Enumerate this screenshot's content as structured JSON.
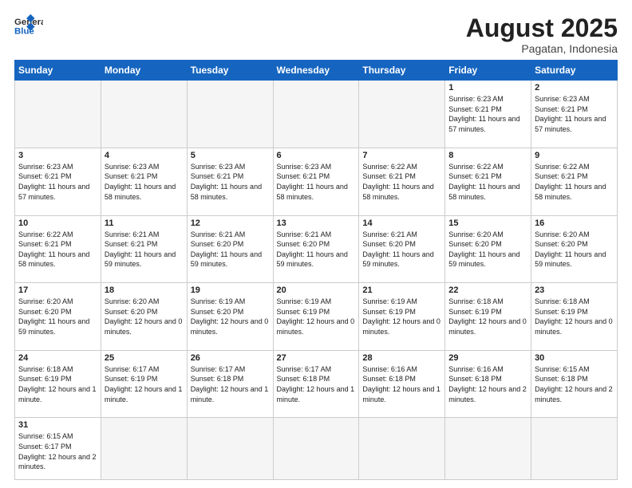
{
  "header": {
    "logo_general": "General",
    "logo_blue": "Blue",
    "month_title": "August 2025",
    "subtitle": "Pagatan, Indonesia"
  },
  "weekdays": [
    "Sunday",
    "Monday",
    "Tuesday",
    "Wednesday",
    "Thursday",
    "Friday",
    "Saturday"
  ],
  "rows": [
    [
      {
        "day": "",
        "info": "",
        "empty": true
      },
      {
        "day": "",
        "info": "",
        "empty": true
      },
      {
        "day": "",
        "info": "",
        "empty": true
      },
      {
        "day": "",
        "info": "",
        "empty": true
      },
      {
        "day": "",
        "info": "",
        "empty": true
      },
      {
        "day": "1",
        "info": "Sunrise: 6:23 AM\nSunset: 6:21 PM\nDaylight: 11 hours\nand 57 minutes."
      },
      {
        "day": "2",
        "info": "Sunrise: 6:23 AM\nSunset: 6:21 PM\nDaylight: 11 hours\nand 57 minutes."
      }
    ],
    [
      {
        "day": "3",
        "info": "Sunrise: 6:23 AM\nSunset: 6:21 PM\nDaylight: 11 hours\nand 57 minutes."
      },
      {
        "day": "4",
        "info": "Sunrise: 6:23 AM\nSunset: 6:21 PM\nDaylight: 11 hours\nand 58 minutes."
      },
      {
        "day": "5",
        "info": "Sunrise: 6:23 AM\nSunset: 6:21 PM\nDaylight: 11 hours\nand 58 minutes."
      },
      {
        "day": "6",
        "info": "Sunrise: 6:23 AM\nSunset: 6:21 PM\nDaylight: 11 hours\nand 58 minutes."
      },
      {
        "day": "7",
        "info": "Sunrise: 6:22 AM\nSunset: 6:21 PM\nDaylight: 11 hours\nand 58 minutes."
      },
      {
        "day": "8",
        "info": "Sunrise: 6:22 AM\nSunset: 6:21 PM\nDaylight: 11 hours\nand 58 minutes."
      },
      {
        "day": "9",
        "info": "Sunrise: 6:22 AM\nSunset: 6:21 PM\nDaylight: 11 hours\nand 58 minutes."
      }
    ],
    [
      {
        "day": "10",
        "info": "Sunrise: 6:22 AM\nSunset: 6:21 PM\nDaylight: 11 hours\nand 58 minutes."
      },
      {
        "day": "11",
        "info": "Sunrise: 6:21 AM\nSunset: 6:21 PM\nDaylight: 11 hours\nand 59 minutes."
      },
      {
        "day": "12",
        "info": "Sunrise: 6:21 AM\nSunset: 6:20 PM\nDaylight: 11 hours\nand 59 minutes."
      },
      {
        "day": "13",
        "info": "Sunrise: 6:21 AM\nSunset: 6:20 PM\nDaylight: 11 hours\nand 59 minutes."
      },
      {
        "day": "14",
        "info": "Sunrise: 6:21 AM\nSunset: 6:20 PM\nDaylight: 11 hours\nand 59 minutes."
      },
      {
        "day": "15",
        "info": "Sunrise: 6:20 AM\nSunset: 6:20 PM\nDaylight: 11 hours\nand 59 minutes."
      },
      {
        "day": "16",
        "info": "Sunrise: 6:20 AM\nSunset: 6:20 PM\nDaylight: 11 hours\nand 59 minutes."
      }
    ],
    [
      {
        "day": "17",
        "info": "Sunrise: 6:20 AM\nSunset: 6:20 PM\nDaylight: 11 hours\nand 59 minutes."
      },
      {
        "day": "18",
        "info": "Sunrise: 6:20 AM\nSunset: 6:20 PM\nDaylight: 12 hours\nand 0 minutes."
      },
      {
        "day": "19",
        "info": "Sunrise: 6:19 AM\nSunset: 6:20 PM\nDaylight: 12 hours\nand 0 minutes."
      },
      {
        "day": "20",
        "info": "Sunrise: 6:19 AM\nSunset: 6:19 PM\nDaylight: 12 hours\nand 0 minutes."
      },
      {
        "day": "21",
        "info": "Sunrise: 6:19 AM\nSunset: 6:19 PM\nDaylight: 12 hours\nand 0 minutes."
      },
      {
        "day": "22",
        "info": "Sunrise: 6:18 AM\nSunset: 6:19 PM\nDaylight: 12 hours\nand 0 minutes."
      },
      {
        "day": "23",
        "info": "Sunrise: 6:18 AM\nSunset: 6:19 PM\nDaylight: 12 hours\nand 0 minutes."
      }
    ],
    [
      {
        "day": "24",
        "info": "Sunrise: 6:18 AM\nSunset: 6:19 PM\nDaylight: 12 hours\nand 1 minute."
      },
      {
        "day": "25",
        "info": "Sunrise: 6:17 AM\nSunset: 6:19 PM\nDaylight: 12 hours\nand 1 minute."
      },
      {
        "day": "26",
        "info": "Sunrise: 6:17 AM\nSunset: 6:18 PM\nDaylight: 12 hours\nand 1 minute."
      },
      {
        "day": "27",
        "info": "Sunrise: 6:17 AM\nSunset: 6:18 PM\nDaylight: 12 hours\nand 1 minute."
      },
      {
        "day": "28",
        "info": "Sunrise: 6:16 AM\nSunset: 6:18 PM\nDaylight: 12 hours\nand 1 minute."
      },
      {
        "day": "29",
        "info": "Sunrise: 6:16 AM\nSunset: 6:18 PM\nDaylight: 12 hours\nand 2 minutes."
      },
      {
        "day": "30",
        "info": "Sunrise: 6:15 AM\nSunset: 6:18 PM\nDaylight: 12 hours\nand 2 minutes."
      }
    ],
    [
      {
        "day": "31",
        "info": "Sunrise: 6:15 AM\nSunset: 6:17 PM\nDaylight: 12 hours\nand 2 minutes.",
        "last": true
      },
      {
        "day": "",
        "info": "",
        "empty": true,
        "last": true
      },
      {
        "day": "",
        "info": "",
        "empty": true,
        "last": true
      },
      {
        "day": "",
        "info": "",
        "empty": true,
        "last": true
      },
      {
        "day": "",
        "info": "",
        "empty": true,
        "last": true
      },
      {
        "day": "",
        "info": "",
        "empty": true,
        "last": true
      },
      {
        "day": "",
        "info": "",
        "empty": true,
        "last": true
      }
    ]
  ]
}
